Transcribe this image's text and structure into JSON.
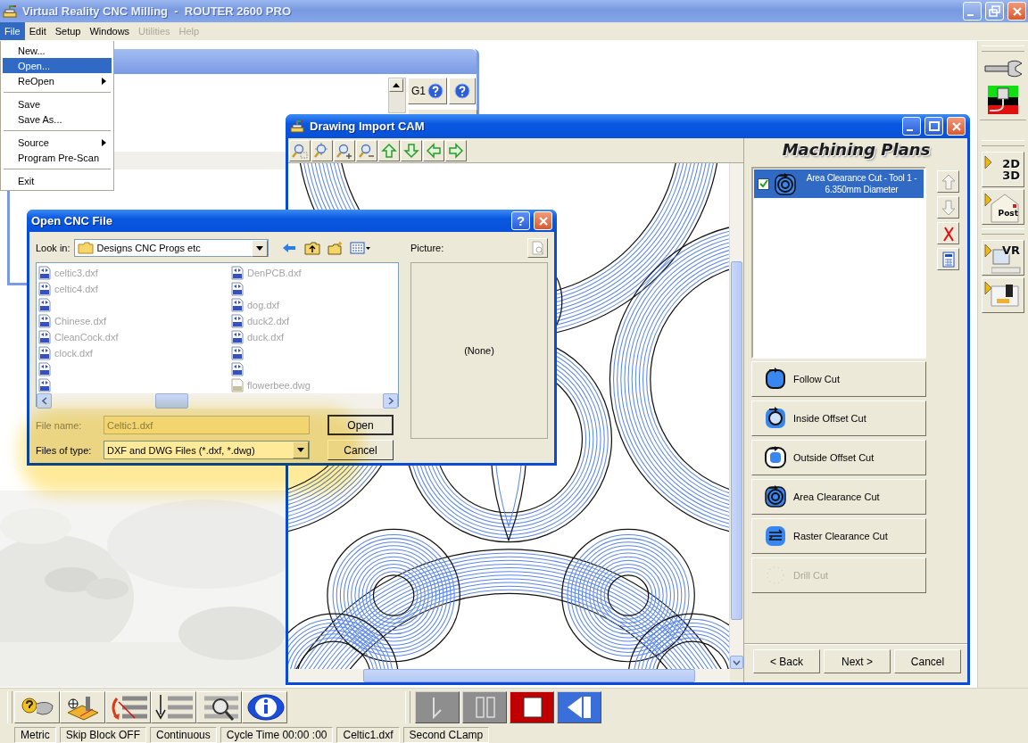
{
  "window": {
    "title": "Virtual Reality CNC Milling  -  ROUTER 2600 PRO"
  },
  "menu_bar": [
    {
      "label": "File",
      "selected": true,
      "disabled": false
    },
    {
      "label": "Edit",
      "selected": false,
      "disabled": false
    },
    {
      "label": "Setup",
      "selected": false,
      "disabled": false
    },
    {
      "label": "Windows",
      "selected": false,
      "disabled": false
    },
    {
      "label": "Utilities",
      "selected": false,
      "disabled": true
    },
    {
      "label": "Help",
      "selected": false,
      "disabled": true
    }
  ],
  "file_menu": [
    {
      "kind": "item",
      "label": "New...",
      "selected": false,
      "submenu": false
    },
    {
      "kind": "item",
      "label": "Open...",
      "selected": true,
      "submenu": false
    },
    {
      "kind": "item",
      "label": "ReOpen",
      "selected": false,
      "submenu": true
    },
    {
      "kind": "separator"
    },
    {
      "kind": "item",
      "label": "Save",
      "selected": false,
      "submenu": false
    },
    {
      "kind": "item",
      "label": "Save As...",
      "selected": false,
      "submenu": false
    },
    {
      "kind": "separator"
    },
    {
      "kind": "item",
      "label": "Source",
      "selected": false,
      "submenu": true
    },
    {
      "kind": "item",
      "label": "Program Pre-Scan",
      "selected": false,
      "submenu": false
    },
    {
      "kind": "separator"
    },
    {
      "kind": "item",
      "label": "Exit",
      "selected": false,
      "submenu": false
    }
  ],
  "code_window": {
    "button_label": "G1"
  },
  "drawing_import": {
    "title": "Drawing Import CAM",
    "panel_title": "Machining Plans",
    "plans": [
      {
        "label": "Area Clearance Cut - Tool 1 - 6.350mm Diameter",
        "checked": true,
        "selected": true
      }
    ],
    "plan_tools": [
      {
        "disabled": true
      },
      {
        "disabled": true
      },
      {
        "disabled": false
      },
      {
        "disabled": false
      }
    ],
    "cut_buttons": [
      {
        "label": "Follow Cut",
        "disabled": false
      },
      {
        "label": "Inside Offset Cut",
        "disabled": false
      },
      {
        "label": "Outside Offset Cut",
        "disabled": false
      },
      {
        "label": "Area Clearance Cut",
        "disabled": false
      },
      {
        "label": "Raster Clearance Cut",
        "disabled": false
      },
      {
        "label": "Drill Cut",
        "disabled": true
      }
    ],
    "nav_buttons": [
      "< Back",
      "Next >",
      "Cancel"
    ]
  },
  "open_dialog": {
    "title": "Open CNC File",
    "help_button": "?",
    "look_in_label": "Look in:",
    "look_in": "Designs CNC Progs etc",
    "picture_label": "Picture:",
    "files": [
      {
        "kind": "dxf",
        "name": "celtic3.dxf"
      },
      {
        "kind": "dxf",
        "name": "celtic4.dxf"
      },
      {
        "kind": "dxf"
      },
      {
        "kind": "dxf",
        "name": "Chinese.dxf"
      },
      {
        "kind": "dxf",
        "name": "CleanCock.dxf"
      },
      {
        "kind": "dxf",
        "name": "clock.dxf"
      },
      {
        "kind": "dxf"
      },
      {
        "kind": "dxf"
      },
      {
        "kind": "dxf",
        "name": "DenPCB.dxf"
      },
      {
        "kind": "dxf"
      },
      {
        "kind": "dxf",
        "name": "dog.dxf"
      },
      {
        "kind": "dxf",
        "name": "duck2.dxf"
      },
      {
        "kind": "dxf",
        "name": "duck.dxf"
      },
      {
        "kind": "dxf"
      },
      {
        "kind": "dxf"
      },
      {
        "kind": "dwg",
        "name": "flowerbee.dwg"
      }
    ],
    "file_name_label": "File name:",
    "file_name": "Celtic1.dxf",
    "file_type_label": "Files of type:",
    "file_type": "DXF and DWG Files (*.dxf, *.dwg)",
    "open_button": "Open",
    "cancel_button": "Cancel",
    "preview": "(None)"
  },
  "right_toolbar": {
    "dim_labels": [
      "2D",
      "3D"
    ],
    "post_label": "Post",
    "vr_label": "VR"
  },
  "status_bar": [
    "Metric",
    "Skip Block OFF",
    "Continuous",
    "Cycle Time 00:00 :00",
    "Celtic1.dxf",
    "Second CLamp"
  ]
}
